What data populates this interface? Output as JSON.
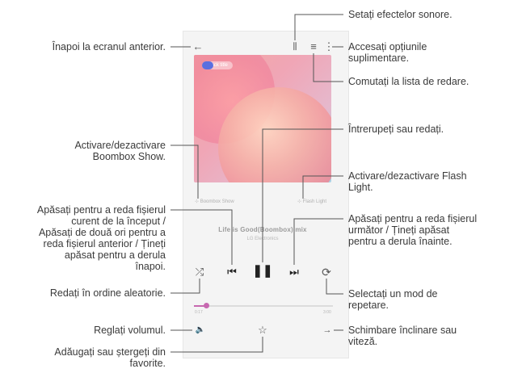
{
  "player": {
    "album_badge": "Track title",
    "boombox_label": "Boombox Show",
    "flashlight_label": "Flash Light",
    "track_title": "Life is Good(Boombox) mix",
    "track_artist": "LG Electronics",
    "time_elapsed": "0:17",
    "time_total": "3:00",
    "progress": 0.09
  },
  "icons": {
    "back": "←",
    "equalizer": "⫼",
    "playlist": "≡",
    "more": "⋮",
    "prev": "⏮",
    "play_pause": "❚❚",
    "next": "⏭",
    "shuffle": "⤮",
    "repeat": "⟳",
    "volume": "🔈",
    "favorite": "☆",
    "speed": "→"
  },
  "callouts": {
    "back": "Înapoi la ecranul anterior.",
    "equalizer": "Setați efectelor sonore.",
    "more": "Accesați opțiunile\nsuplimentare.",
    "playlist": "Comutați la lista de redare.",
    "play_pause": "Întrerupeți sau redați.",
    "boombox": "Activare/dezactivare\nBoombox Show.",
    "flashlight": "Activare/dezactivare Flash\nLight.",
    "prev": "Apăsați pentru a reda fișierul\ncurent de la început /\nApăsați de două ori pentru a\nreda fișierul anterior / Țineți\napăsat pentru a derula\nînapoi.",
    "next": "Apăsați pentru a reda fișierul\nurmător / Țineți apăsat\npentru a derula înainte.",
    "shuffle": "Redați în ordine aleatorie.",
    "repeat": "Selectați un mod de\nrepetare.",
    "volume": "Reglați volumul.",
    "speed": "Schimbare înclinare sau\nviteză.",
    "favorite": "Adăugați sau ștergeți din\nfavorite."
  }
}
